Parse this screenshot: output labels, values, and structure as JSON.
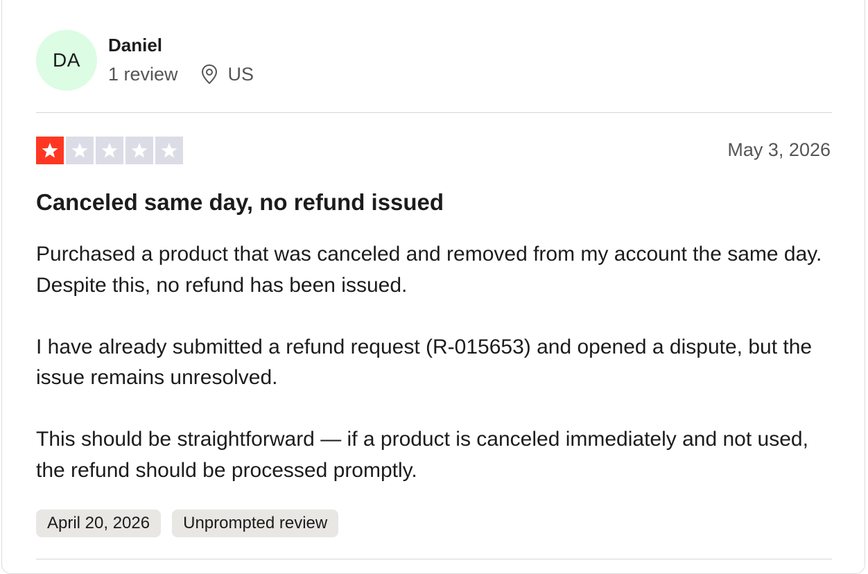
{
  "reviewer": {
    "initials": "DA",
    "name": "Daniel",
    "review_count": "1 review",
    "location": "US",
    "avatar_color": "#dcfce3"
  },
  "rating": {
    "stars": 1,
    "max": 5,
    "filled_color": "#ff3722",
    "empty_color": "#dcdce6"
  },
  "review": {
    "date": "May 3, 2026",
    "title": "Canceled same day, no refund issued",
    "paragraphs": [
      "Purchased a product that was canceled and removed from my account the same day. Despite this, no refund has been issued.",
      "I have already submitted a refund request (R-015653) and opened a dispute, but the issue remains unresolved.",
      "This should be straightforward — if a product is canceled immediately and not used, the refund should be processed promptly."
    ],
    "tags": [
      "April 20, 2026",
      "Unprompted review"
    ]
  },
  "icons": {
    "location": "location-pin-icon",
    "star": "star-icon"
  }
}
